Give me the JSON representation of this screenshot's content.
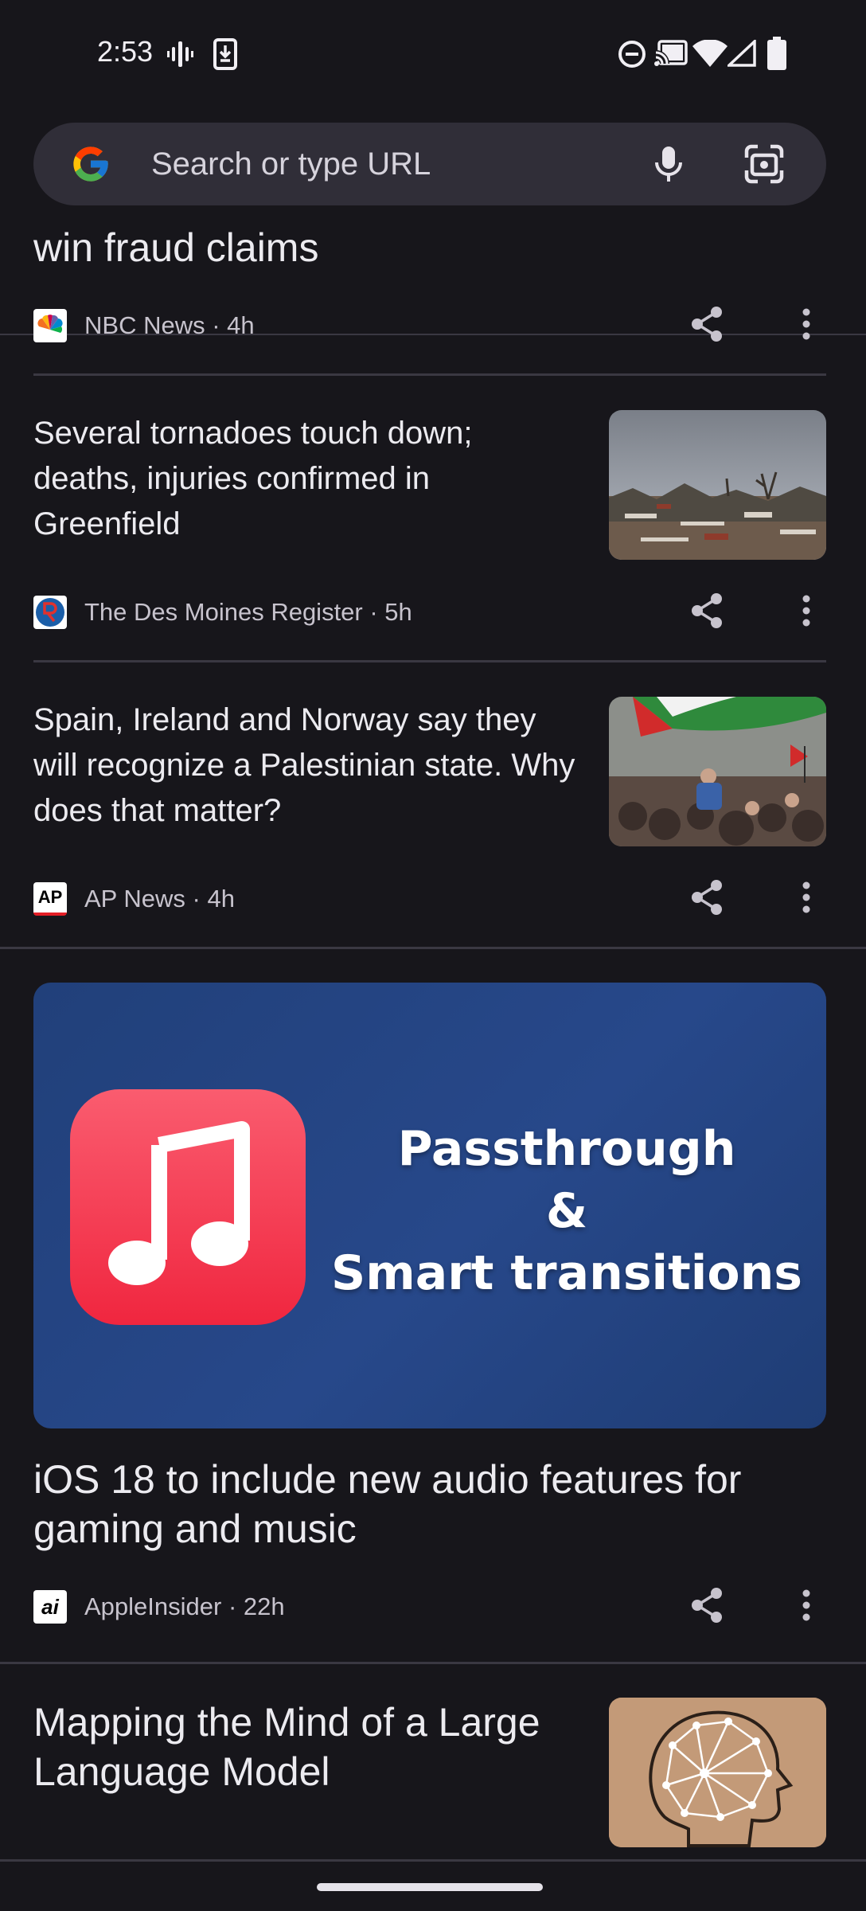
{
  "status_bar": {
    "time": "2:53",
    "icons": [
      "vibrate-icon",
      "download-icon",
      "do-not-disturb-icon",
      "cast-icon",
      "wifi-icon",
      "signal-icon",
      "battery-icon"
    ]
  },
  "toolbar": {
    "search_placeholder": "Search or type URL",
    "icons": [
      "google-logo",
      "mic-icon",
      "lens-icon"
    ]
  },
  "feed": {
    "cards": [
      {
        "title": "win fraud claims",
        "source": "NBC News · 4h"
      },
      {
        "title": "Several tornadoes touch down; deaths, injuries confirmed in Greenfield",
        "source": "The Des Moines Register · 5h"
      },
      {
        "title": "Spain, Ireland and Norway say they will recognize a Palestinian state. Why does that matter?",
        "source": "AP News · 4h"
      },
      {
        "title": "iOS 18 to include new audio features for gaming and music",
        "source": "AppleInsider · 22h",
        "hero_text_line1": "Passthrough",
        "hero_text_line2": "&",
        "hero_text_line3": "Smart transitions"
      },
      {
        "title": "Mapping the Mind of a Large Language Model"
      }
    ],
    "source_logos": {
      "ap": "AP",
      "ai": "ai"
    }
  },
  "colors": {
    "background": "#17161b",
    "omnibox": "#302e38",
    "hero_bg": "#22407a",
    "music_red": "#f0304a"
  }
}
